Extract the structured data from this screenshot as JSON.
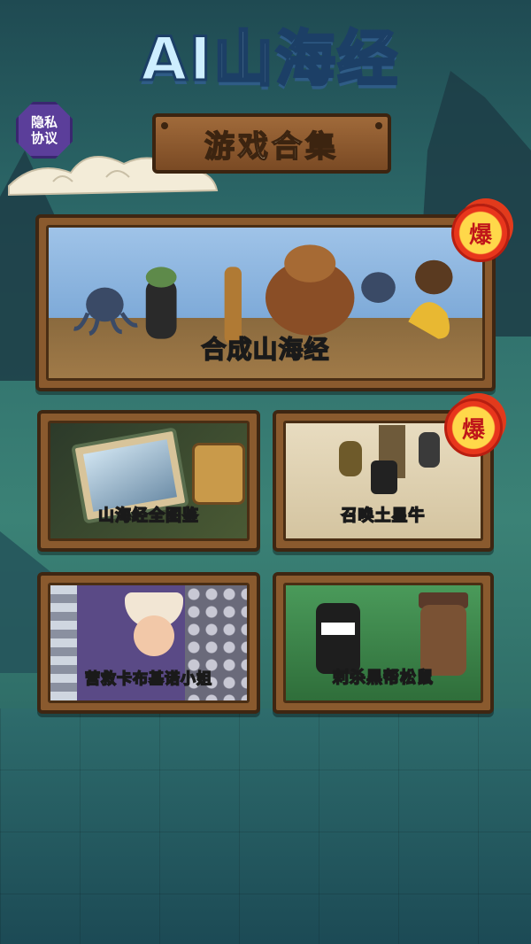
{
  "header": {
    "title": "AI山海经",
    "subtitle": "游戏合集",
    "privacy_line1": "隐私",
    "privacy_line2": "协议"
  },
  "featured": {
    "label": "合成山海经",
    "badge": "爆"
  },
  "games": [
    {
      "label": "山海经全图鉴",
      "badge": ""
    },
    {
      "label": "召唤土星牛",
      "badge": "爆"
    },
    {
      "label": "营救卡布基诺小姐",
      "badge": ""
    },
    {
      "label": "刺杀黑帮松鼠",
      "badge": ""
    }
  ],
  "colors": {
    "frame": "#8a5a2e",
    "badge": "#e8361c",
    "title": "#cdeeff"
  }
}
